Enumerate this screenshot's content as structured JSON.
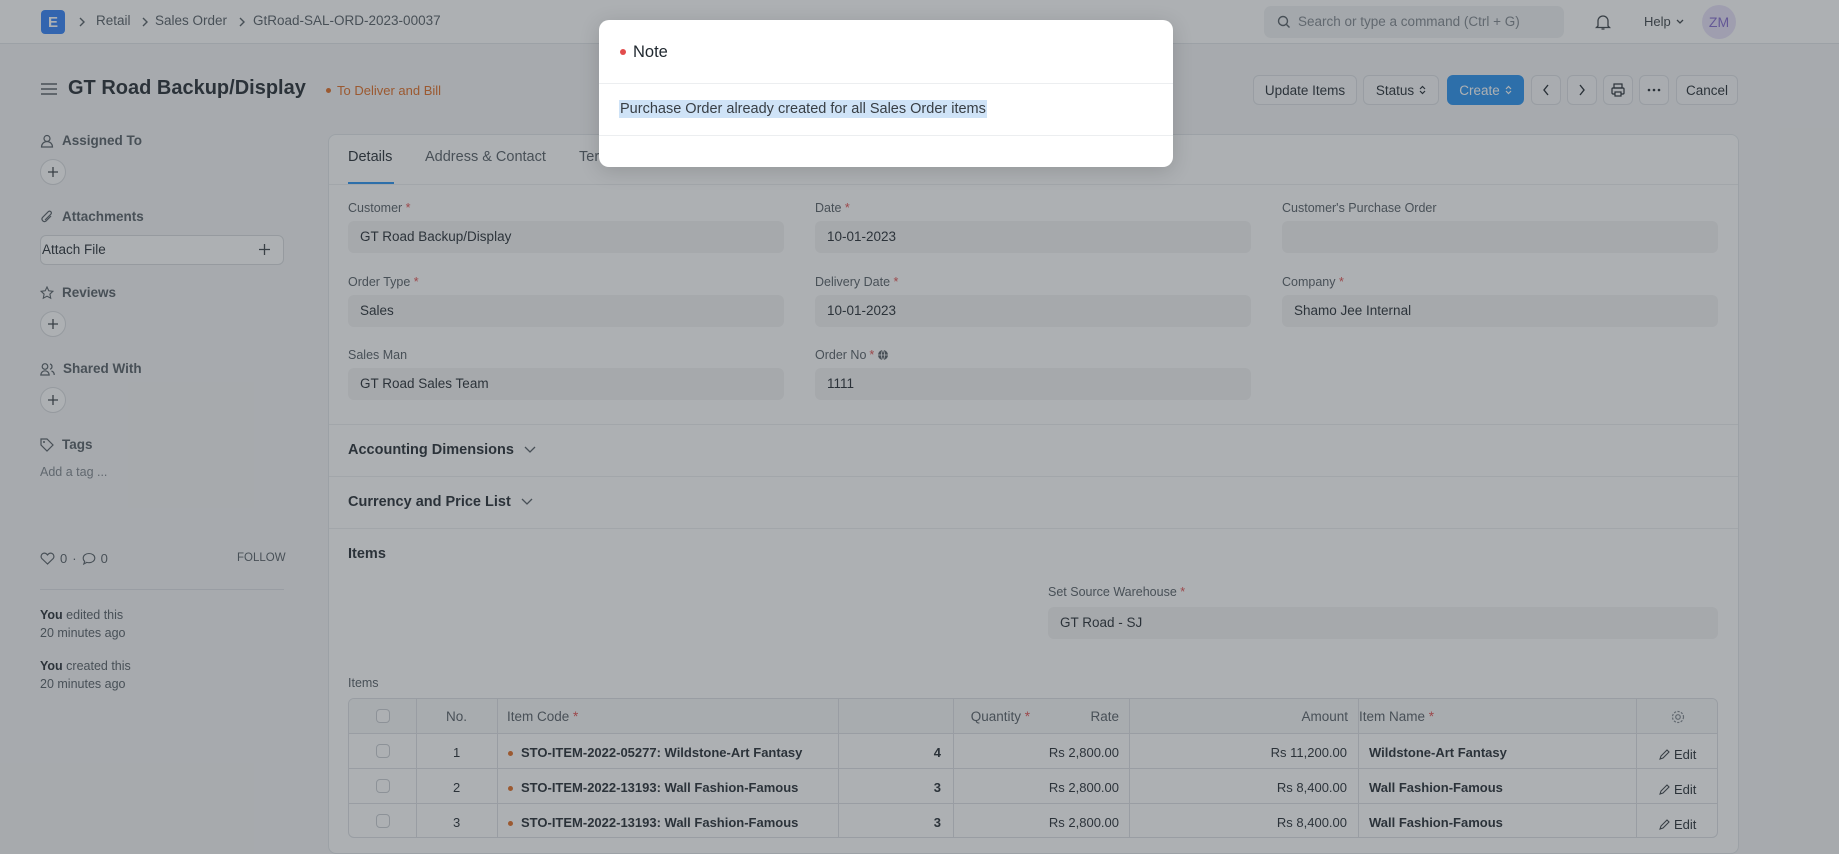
{
  "navbar": {
    "logo": "E",
    "breadcrumbs": [
      "Retail",
      "Sales Order",
      "GtRoad-SAL-ORD-2023-00037"
    ],
    "search_placeholder": "Search or type a command (Ctrl + G)",
    "help": "Help",
    "avatar": "ZM"
  },
  "page": {
    "title": "GT Road Backup/Display",
    "status": "To Deliver and Bill",
    "actions": {
      "update_items": "Update Items",
      "status": "Status",
      "create": "Create",
      "cancel": "Cancel"
    }
  },
  "sidebar": {
    "assigned_to": "Assigned To",
    "attachments": "Attachments",
    "attach_file": "Attach File",
    "reviews": "Reviews",
    "shared_with": "Shared With",
    "tags": "Tags",
    "add_tag": "Add a tag ...",
    "likes": "0",
    "comments": "0",
    "follow": "FOLLOW",
    "activity": [
      {
        "user": "You",
        "action": " edited this",
        "time": "20 minutes ago"
      },
      {
        "user": "You",
        "action": " created this",
        "time": "20 minutes ago"
      }
    ]
  },
  "tabs": [
    "Details",
    "Address & Contact",
    "Ter"
  ],
  "form": {
    "customer": {
      "label": "Customer",
      "value": "GT Road Backup/Display"
    },
    "date": {
      "label": "Date",
      "value": "10-01-2023"
    },
    "customer_po": {
      "label": "Customer's Purchase Order",
      "value": ""
    },
    "order_type": {
      "label": "Order Type",
      "value": "Sales"
    },
    "delivery_date": {
      "label": "Delivery Date",
      "value": "10-01-2023"
    },
    "company": {
      "label": "Company",
      "value": "Shamo Jee Internal"
    },
    "sales_man": {
      "label": "Sales Man",
      "value": "GT Road Sales Team"
    },
    "order_no": {
      "label": "Order No",
      "value": "1111"
    }
  },
  "sections": {
    "accounting": "Accounting Dimensions",
    "currency": "Currency and Price List",
    "items": "Items",
    "items_table_label": "Items"
  },
  "warehouse": {
    "label": "Set Source Warehouse",
    "value": "GT Road - SJ"
  },
  "table": {
    "headers": {
      "no": "No.",
      "item_code": "Item Code",
      "quantity": "Quantity",
      "rate": "Rate",
      "amount": "Amount",
      "item_name": "Item Name"
    },
    "edit_label": "Edit",
    "rows": [
      {
        "no": "1",
        "item_code": "STO-ITEM-2022-05277: Wildstone-Art Fantasy",
        "quantity": "4",
        "rate": "Rs 2,800.00",
        "amount": "Rs 11,200.00",
        "item_name": "Wildstone-Art Fantasy"
      },
      {
        "no": "2",
        "item_code": "STO-ITEM-2022-13193: Wall Fashion-Famous",
        "quantity": "3",
        "rate": "Rs 2,800.00",
        "amount": "Rs 8,400.00",
        "item_name": "Wall Fashion-Famous"
      },
      {
        "no": "3",
        "item_code": "STO-ITEM-2022-13193: Wall Fashion-Famous",
        "quantity": "3",
        "rate": "Rs 2,800.00",
        "amount": "Rs 8,400.00",
        "item_name": "Wall Fashion-Famous"
      }
    ]
  },
  "modal": {
    "title": "Note",
    "message": "Purchase Order already created for all Sales Order items"
  },
  "colors": {
    "primary": "#2490ef",
    "indicator_orange": "#e06a1f",
    "required_red": "#e24c4c"
  }
}
